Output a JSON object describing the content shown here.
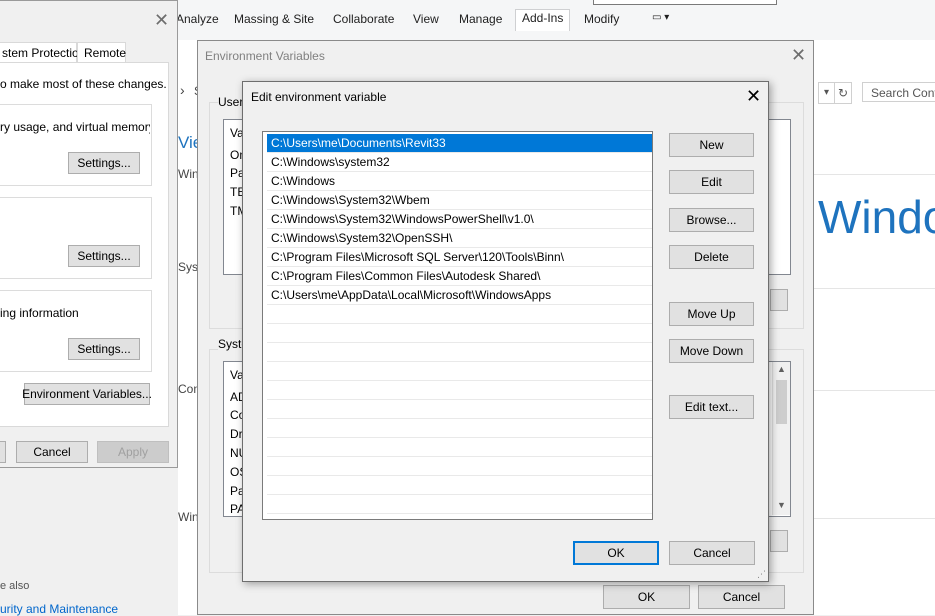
{
  "ribbon": {
    "tabs": [
      "Analyze",
      "Massing & Site",
      "Collaborate",
      "View",
      "Manage",
      "Add-Ins",
      "Modify"
    ],
    "active_tab": "Add-Ins",
    "options_glyph": "▭ ▾"
  },
  "control_panel": {
    "nav_arrow": "›",
    "nav_letter": "S",
    "search_placeholder": "Search Cont",
    "heading_fragment": "Vie",
    "big_title_fragment": "Windo",
    "left_labels": [
      "Win",
      "Syst",
      "Con",
      "Win"
    ],
    "see_also": "e also",
    "security_link": "urity and Maintenance"
  },
  "system_properties": {
    "tabs": [
      "stem Protection",
      "Remote"
    ],
    "intro": "o make most of these changes.",
    "perf_text": "ry usage, and virtual memory",
    "startup_text": "ing information",
    "settings_label": "Settings...",
    "env_button": "Environment Variables...",
    "cancel": "Cancel",
    "apply": "Apply"
  },
  "env_vars": {
    "title": "Environment Variables",
    "user_group": "User",
    "user_col": "Va",
    "user_rows": [
      "On",
      "Pa",
      "TE",
      "TM"
    ],
    "system_group": "Syste",
    "system_col": "Va",
    "system_rows": [
      "AD",
      "Co",
      "Dr",
      "NU",
      "OS",
      "Pa",
      "PA"
    ],
    "ok": "OK",
    "cancel": "Cancel"
  },
  "edit_dialog": {
    "title": "Edit environment variable",
    "entries": [
      "C:\\Users\\me\\Documents\\Revit33",
      "C:\\Windows\\system32",
      "C:\\Windows",
      "C:\\Windows\\System32\\Wbem",
      "C:\\Windows\\System32\\WindowsPowerShell\\v1.0\\",
      "C:\\Windows\\System32\\OpenSSH\\",
      "C:\\Program Files\\Microsoft SQL Server\\120\\Tools\\Binn\\",
      "C:\\Program Files\\Common Files\\Autodesk Shared\\",
      "C:\\Users\\me\\AppData\\Local\\Microsoft\\WindowsApps"
    ],
    "buttons": {
      "new": "New",
      "edit": "Edit",
      "browse": "Browse...",
      "delete": "Delete",
      "move_up": "Move Up",
      "move_down": "Move Down",
      "edit_text": "Edit text..."
    },
    "ok": "OK",
    "cancel": "Cancel"
  },
  "colors": {
    "accent": "#0078d7",
    "title_blue": "#1e73be"
  }
}
